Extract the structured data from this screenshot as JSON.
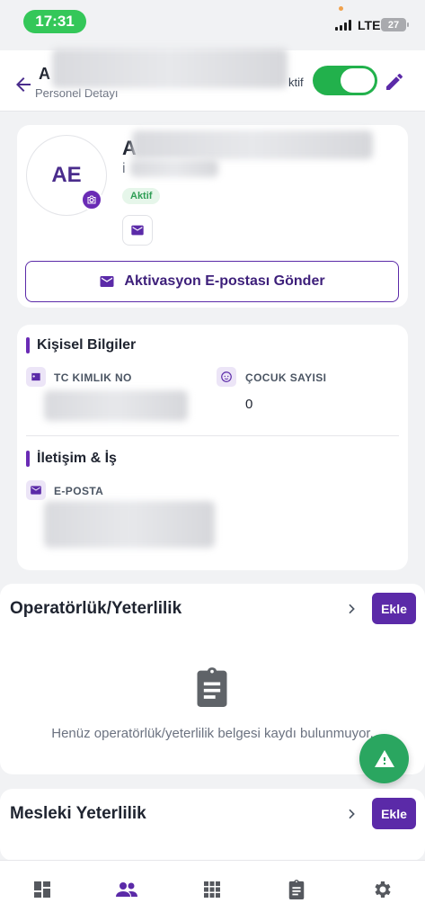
{
  "status_bar": {
    "time": "17:31",
    "network": "LTE",
    "battery": "27"
  },
  "header": {
    "title_initial": "A",
    "subtitle": "Personel Detayı",
    "status_label": "ktif",
    "toggle_on": true
  },
  "profile": {
    "avatar_initials": "AE",
    "name_initial": "A",
    "role_initial": "i",
    "status_badge": "Aktif",
    "activation_button": "Aktivasyon E-postası Gönder"
  },
  "personal_info": {
    "section_title": "Kişisel Bilgiler",
    "tc_label": "TC KIMLIK NO",
    "children_label": "ÇOCUK SAYISI",
    "children_value": "0"
  },
  "contact": {
    "section_title": "İletişim & İş",
    "email_label": "E-POSTA"
  },
  "operator_section": {
    "title": "Operatörlük/Yeterlilik",
    "add_label": "Ekle",
    "empty_message": "Henüz operatörlük/yeterlilik belgesi kaydı bulunmuyor."
  },
  "vocational_section": {
    "title": "Mesleki Yeterlilik",
    "add_label": "Ekle"
  },
  "bottom_nav": {
    "items": [
      "dashboard-icon",
      "people-icon",
      "apps-grid-icon",
      "clipboard-icon",
      "settings-icon"
    ],
    "active": "people-icon"
  },
  "colors": {
    "accent": "#5b2aa8",
    "success": "#22b14c",
    "fab": "#2aa660"
  }
}
